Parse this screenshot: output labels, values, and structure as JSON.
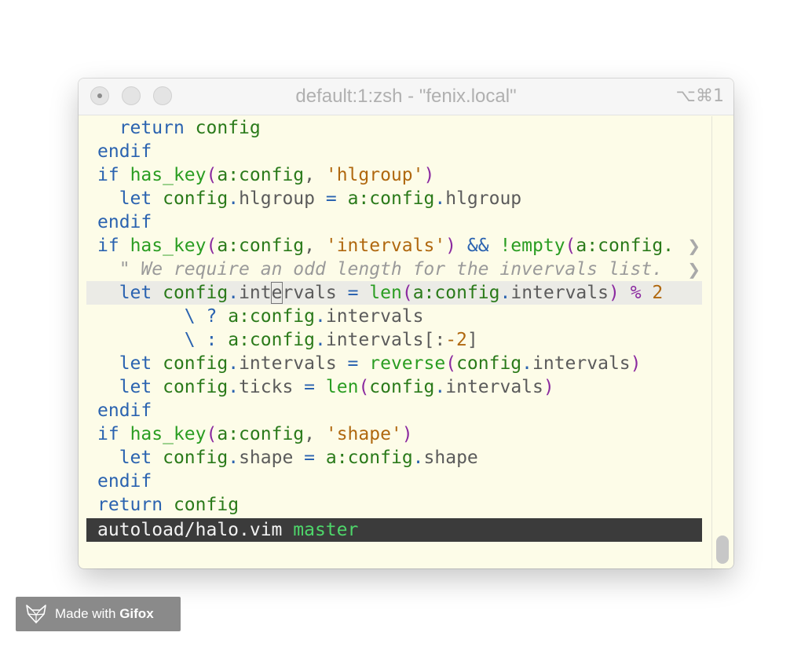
{
  "window": {
    "title": "default:1:zsh - \"fenix.local\"",
    "shortcut": "⌥⌘1"
  },
  "code": {
    "l1": {
      "a": "return",
      "b": "config"
    },
    "l2": {
      "a": "endif"
    },
    "l3": {
      "a": "if",
      "b": "has_key",
      "c": "(",
      "d": "a:config",
      "e": ", ",
      "f": "'hlgroup'",
      "g": ")"
    },
    "l4": {
      "a": "let",
      "b": "config",
      "c": ".",
      "d": "hlgroup",
      "e": "=",
      "f": "a:config",
      "g": ".",
      "h": "hlgroup"
    },
    "l5": {
      "a": "endif"
    },
    "l6": {
      "a": "if",
      "b": "has_key",
      "c": "(",
      "d": "a:config",
      "e": ", ",
      "f": "'intervals'",
      "g": ")",
      "h": "&&",
      "i": "!empty",
      "j": "(",
      "k": "a:config.",
      "trunc": "❯"
    },
    "l7": {
      "a": "\" We require an odd length for the invervals list.",
      "trunc": "❯"
    },
    "l8": {
      "a": "let",
      "b": "config",
      "c": ".",
      "d1": "int",
      "d2": "e",
      "d3": "rvals",
      "e": "=",
      "f": "len",
      "g": "(",
      "h": "a:config",
      "i": ".",
      "j": "intervals",
      "k": ")",
      "l": "%",
      "m": "2"
    },
    "l9": {
      "a": "\\",
      "b": "?",
      "c": "a:config",
      "d": ".",
      "e": "intervals"
    },
    "l10": {
      "a": "\\",
      "b": ":",
      "c": "a:config",
      "d": ".",
      "e": "intervals[:",
      "f": "-2",
      "g": "]"
    },
    "l11": {
      "a": "let",
      "b": "config",
      "c": ".",
      "d": "intervals",
      "e": "=",
      "f": "reverse",
      "g": "(",
      "h": "config",
      "i": ".",
      "j": "intervals",
      "k": ")"
    },
    "l12": {
      "a": "let",
      "b": "config",
      "c": ".",
      "d": "ticks",
      "e": "=",
      "f": "len",
      "g": "(",
      "h": "config",
      "i": ".",
      "j": "intervals",
      "k": ")"
    },
    "l13": {
      "a": "endif"
    },
    "l14": {
      "a": "if",
      "b": "has_key",
      "c": "(",
      "d": "a:config",
      "e": ", ",
      "f": "'shape'",
      "g": ")"
    },
    "l15": {
      "a": "let",
      "b": "config",
      "c": ".",
      "d": "shape",
      "e": "=",
      "f": "a:config",
      "g": ".",
      "h": "shape"
    },
    "l16": {
      "a": "endif"
    },
    "l17": {
      "a": "return",
      "b": "config"
    }
  },
  "statusbar": {
    "file": "autoload/halo.vim",
    "branch": "master"
  },
  "badge": {
    "prefix": "Made with ",
    "brand": "Gifox"
  },
  "icons": {
    "fox": "fox-icon"
  }
}
